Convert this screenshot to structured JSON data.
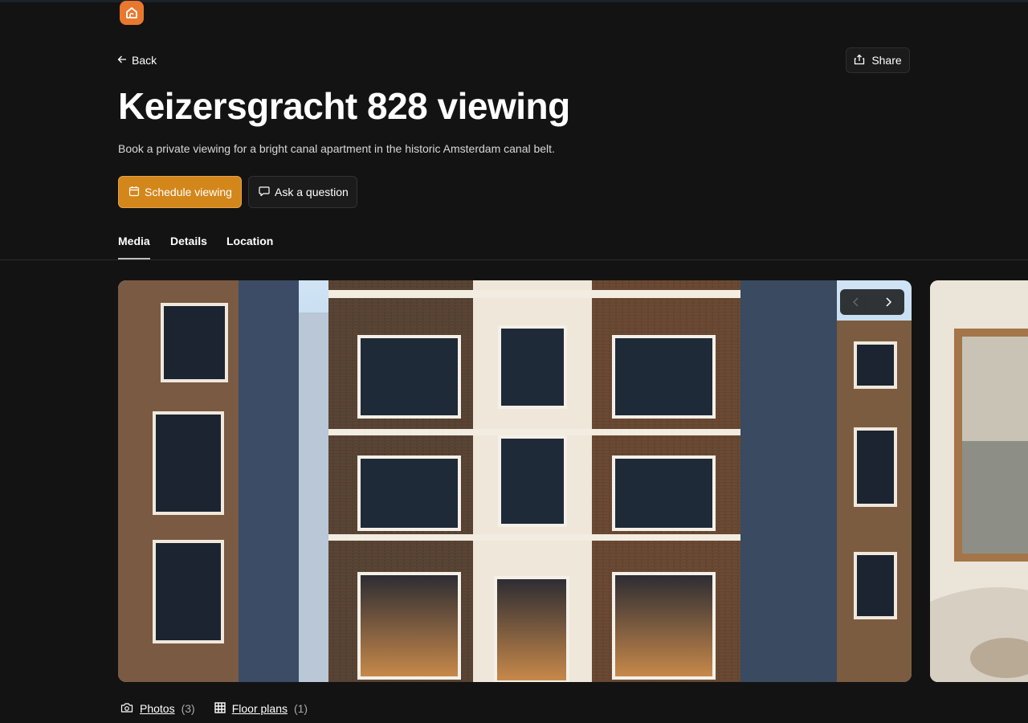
{
  "header": {
    "back_label": "Back",
    "share_label": "Share"
  },
  "listing": {
    "title": "Keizersgracht 828 viewing",
    "description": "Book a private viewing for a bright canal apartment in the historic Amsterdam canal belt."
  },
  "actions": {
    "schedule_label": "Schedule viewing",
    "ask_label": "Ask a question"
  },
  "tabs": [
    {
      "label": "Media",
      "active": true
    },
    {
      "label": "Details",
      "active": false
    },
    {
      "label": "Location",
      "active": false
    }
  ],
  "media": {
    "photos_label": "Photos",
    "photos_count": "(3)",
    "floorplans_label": "Floor plans",
    "floorplans_count": "(1)"
  },
  "colors": {
    "brand": "#e8782e",
    "primary_button": "#d3871b",
    "background": "#131313"
  },
  "icons": [
    "home-logo-icon",
    "arrow-left-icon",
    "share-icon",
    "calendar-icon",
    "chat-icon",
    "chevron-left-icon",
    "chevron-right-icon",
    "camera-icon",
    "floorplan-grid-icon"
  ]
}
